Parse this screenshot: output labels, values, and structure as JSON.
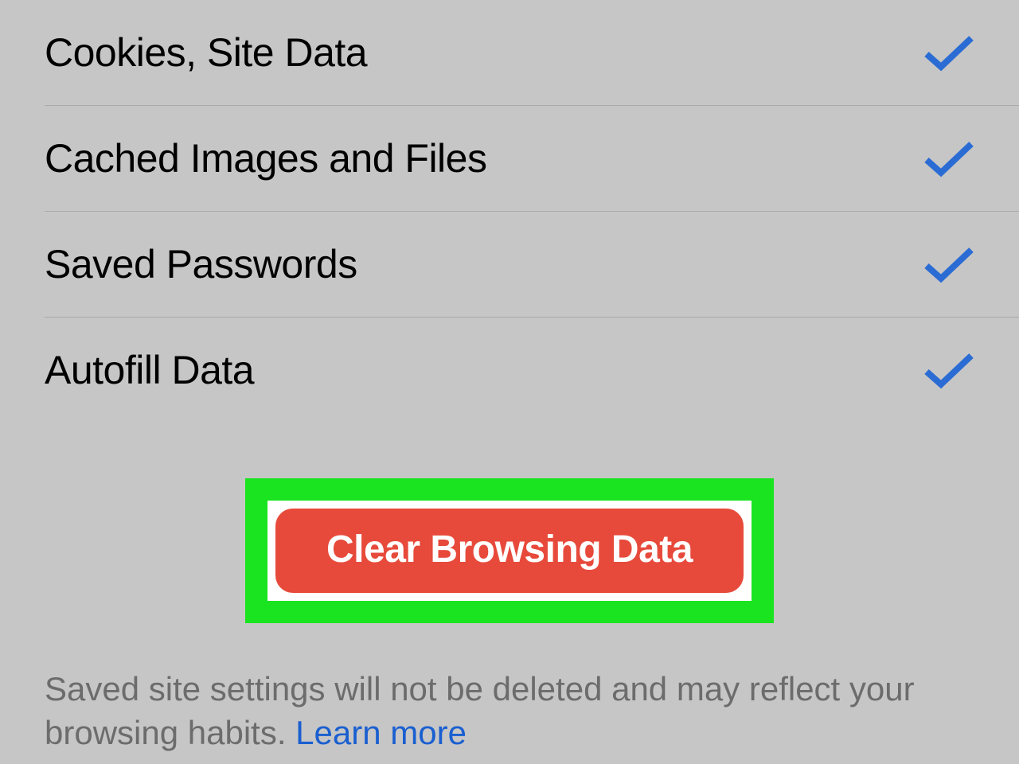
{
  "items": [
    {
      "label": "Cookies, Site Data",
      "checked": true
    },
    {
      "label": "Cached Images and Files",
      "checked": true
    },
    {
      "label": "Saved Passwords",
      "checked": true
    },
    {
      "label": "Autofill Data",
      "checked": true
    }
  ],
  "clear_button_label": "Clear Browsing Data",
  "footer_text": "Saved site settings will not be deleted and may reflect your browsing habits. ",
  "learn_more_label": "Learn more",
  "colors": {
    "accent_blue": "#2b6cd4",
    "button_red": "#e74a3b",
    "highlight_green": "#19e41f"
  }
}
